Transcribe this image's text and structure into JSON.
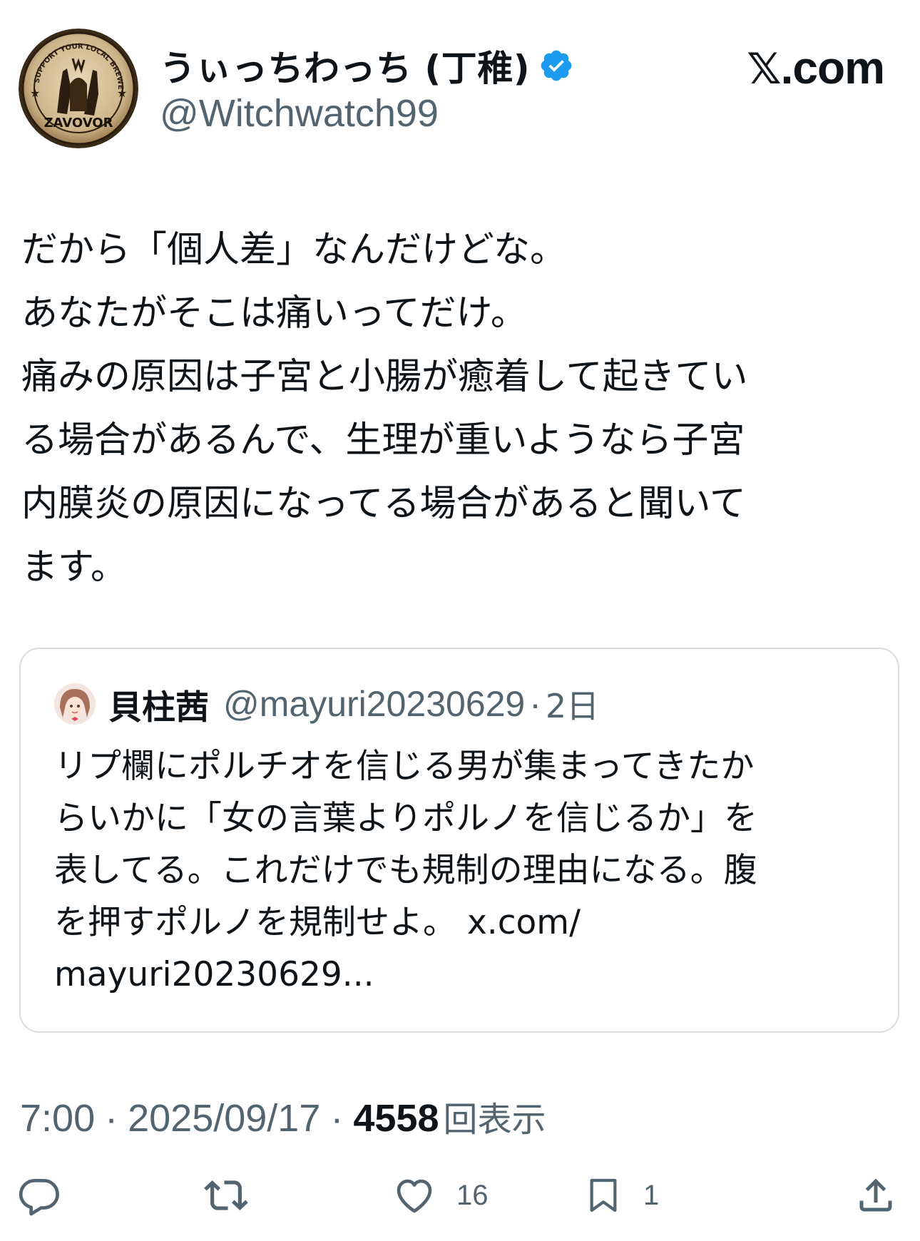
{
  "author": {
    "display_name": "うぃっちわっち (丁稚)",
    "handle": "@Witchwatch99",
    "verified": true,
    "avatar_icon": "brewery-logo-avatar",
    "avatar_logo_text": "ZAVOVOR",
    "avatar_ring_text": "SUPPORT YOUR LOCAL BREWERY"
  },
  "brand": {
    "x_glyph": "𝕏",
    "domain": ".com"
  },
  "tweet": {
    "text": "だから「個人差」なんだけどな。\nあなたがそこは痛いってだけ。\n痛みの原因は子宮と小腸が癒着して起きてい\nる場合があるんで、生理が重いようなら子宮\n内膜炎の原因になってる場合があると聞いて\nます。"
  },
  "quoted": {
    "display_name": "貝柱茜",
    "handle": "@mayuri20230629",
    "separator": "·",
    "time": "2日",
    "text": "リプ欄にポルチオを信じる男が集まってきたか\nらいかに「女の言葉よりポルノを信じるか」を\n表してる。これだけでも規制の理由になる。腹\nを押すポルノを規制せよ。 x.com/\nmayuri20230629..."
  },
  "meta": {
    "time": "7:00",
    "separator": "·",
    "date": "2025/09/17",
    "views": "4558",
    "views_label": "回表示"
  },
  "actions": {
    "reply_count": "",
    "retweet_count": "",
    "like_count": "16",
    "bookmark_count": "1"
  },
  "colors": {
    "text_primary": "#0f1419",
    "text_secondary": "#536471",
    "verified_blue": "#1d9bf0",
    "border": "#d9dee2",
    "icon_gray": "#536471"
  }
}
